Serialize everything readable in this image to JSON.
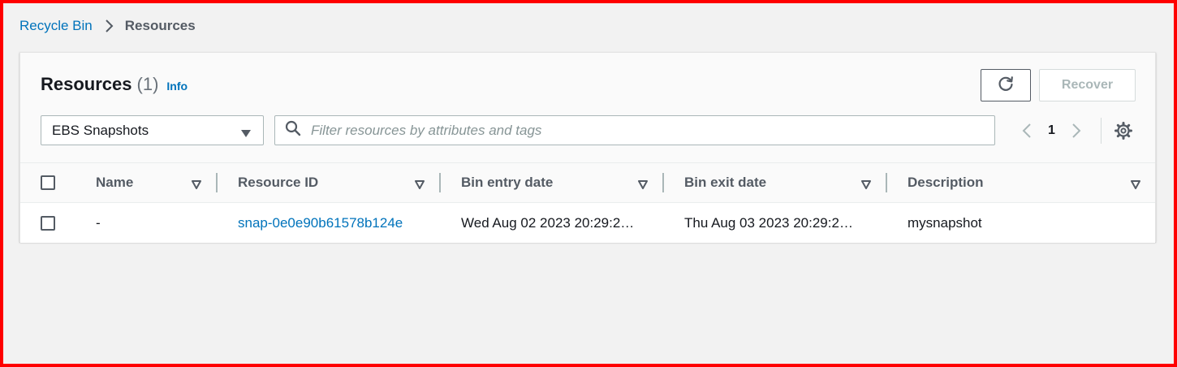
{
  "breadcrumb": {
    "items": [
      {
        "label": "Recycle Bin"
      },
      {
        "label": "Resources"
      }
    ]
  },
  "panel": {
    "title": "Resources",
    "count": "(1)",
    "info_label": "Info"
  },
  "actions": {
    "refresh_icon": "refresh-icon",
    "recover_label": "Recover"
  },
  "resource_type_select": {
    "value": "EBS Snapshots"
  },
  "filter": {
    "placeholder": "Filter resources by attributes and tags"
  },
  "pagination": {
    "current_page": "1"
  },
  "table": {
    "columns": [
      {
        "label": "Name"
      },
      {
        "label": "Resource ID"
      },
      {
        "label": "Bin entry date"
      },
      {
        "label": "Bin exit date"
      },
      {
        "label": "Description"
      }
    ],
    "rows": [
      {
        "name": "-",
        "resource_id": "snap-0e0e90b61578b124e",
        "bin_entry_date": "Wed Aug 02 2023 20:29:2…",
        "bin_exit_date": "Thu Aug 03 2023 20:29:2…",
        "description": "mysnapshot"
      }
    ]
  },
  "colors": {
    "link": "#0073bb",
    "frame": "#ff0000",
    "disabled_text": "#aab7b8"
  }
}
